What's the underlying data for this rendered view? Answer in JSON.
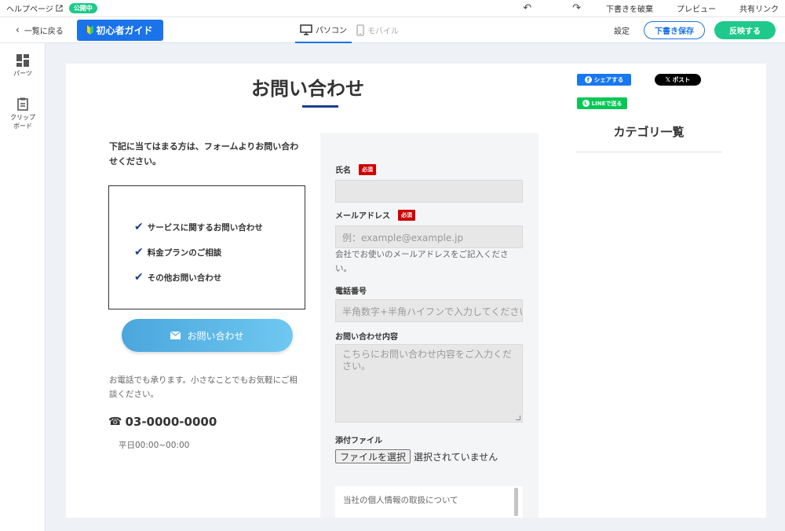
{
  "topbar": {
    "help_label": "ヘルプページ",
    "status_badge": "公開中",
    "discard_draft": "下書きを破棄",
    "preview": "プレビュー",
    "share_link": "共有リンク"
  },
  "toolbar": {
    "back_label": "一覧に戻る",
    "guide_label": "初心者ガイド",
    "tab_pc": "パソコン",
    "tab_mobile": "モバイル",
    "settings": "設定",
    "save_draft": "下書き保存",
    "publish": "反映する"
  },
  "leftrail": {
    "parts": "パーツ",
    "clipboard_line1": "クリップ",
    "clipboard_line2": "ボード"
  },
  "page": {
    "title": "お問い合わせ",
    "intro": "下記に当てはまる方は、フォームよりお問い合わせください。",
    "checklist": [
      "サービスに関するお問い合わせ",
      "料金プランのご相談",
      "その他お問い合わせ"
    ],
    "contact_button": "お問い合わせ",
    "phone_note": "お電話でも承ります。小さなことでもお気軽にご相談ください。",
    "phone_number": "03-0000-0000",
    "hours": "平日00:00~00:00"
  },
  "form": {
    "required_badge": "必須",
    "name_label": "氏名",
    "email_label": "メールアドレス",
    "email_placeholder": "例：example@example.jp",
    "email_help": "会社でお使いのメールアドレスをご記入ください。",
    "phone_label": "電話番号",
    "phone_placeholder": "半角数字+半角ハイフンで入力してください",
    "message_label": "お問い合わせ内容",
    "message_placeholder": "こちらにお問い合わせ内容をご入力ください。",
    "file_label": "添付ファイル",
    "file_button": "ファイルを選択",
    "file_status": "選択されていません",
    "privacy_text": "当社の個人情報の取扱について"
  },
  "sidebar": {
    "share_facebook": "シェアする",
    "share_x": "ポスト",
    "share_line": "LINEで送る",
    "category_title": "カテゴリ一覧"
  }
}
